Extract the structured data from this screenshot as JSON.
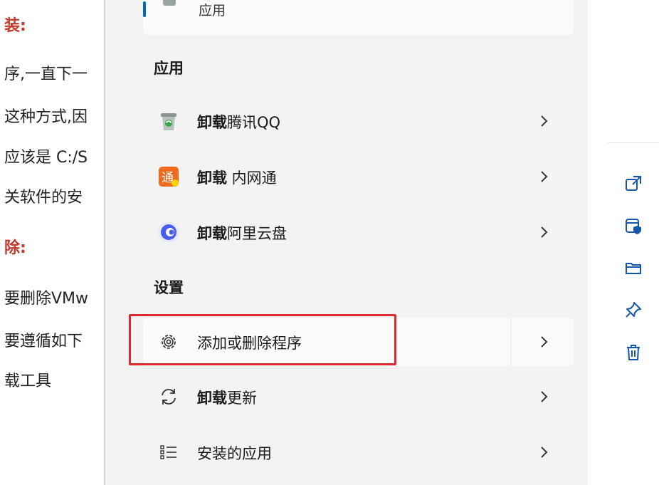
{
  "background_doc": {
    "lines": [
      "装:",
      "序,一直下一",
      "这种方式,因",
      "应该是 C:/S",
      "关软件的安",
      "除:",
      "要删除VMw",
      "要遵循如下",
      "载工具"
    ]
  },
  "search_panel": {
    "top_result_label": "应用",
    "section_apps": "应用",
    "apps": [
      {
        "action": "卸载",
        "name": "腾讯QQ",
        "icon": "recycle-bin-icon"
      },
      {
        "action": "卸载",
        "name": " 内网通",
        "icon": "neiwangtong-icon"
      },
      {
        "action": "卸载",
        "name": "阿里云盘",
        "icon": "aliyun-drive-icon"
      }
    ],
    "section_settings": "设置",
    "settings": [
      {
        "prefix": "",
        "name": "添加或删除程序",
        "icon": "gear-icon"
      },
      {
        "prefix": "卸载",
        "name": "更新",
        "icon": "refresh-icon"
      },
      {
        "prefix": "",
        "name": "安装的应用",
        "icon": "list-icon"
      }
    ]
  },
  "right_actions": [
    "open-external-icon",
    "run-as-admin-icon",
    "open-folder-icon",
    "pin-icon",
    "delete-icon"
  ],
  "colors": {
    "accent": "#0067c0",
    "highlight": "#e0282e",
    "heading_red": "#c0392b"
  }
}
